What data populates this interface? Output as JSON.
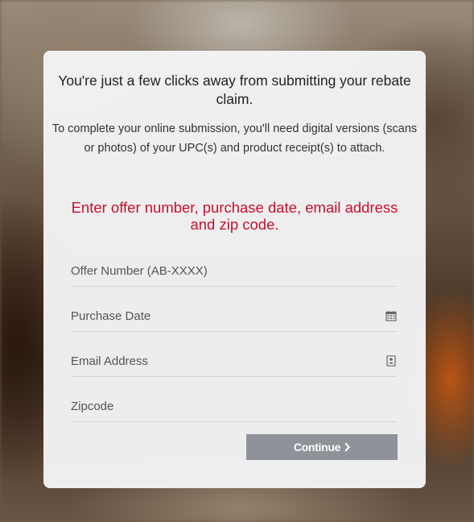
{
  "headline": "You're just a few clicks away from submitting your rebate claim.",
  "subtext": "To complete your online submission, you'll need digital versions (scans or photos) of your UPC(s) and product receipt(s) to attach.",
  "instruction": "Enter offer number, purchase date, email address and zip code.",
  "form": {
    "offer_number": {
      "placeholder": "Offer Number (AB-XXXX)",
      "value": ""
    },
    "purchase_date": {
      "placeholder": "Purchase Date",
      "value": "",
      "icon": "calendar-icon"
    },
    "email": {
      "placeholder": "Email Address",
      "value": "",
      "icon": "contact-card-icon"
    },
    "zipcode": {
      "placeholder": "Zipcode",
      "value": ""
    }
  },
  "continue_button": {
    "label": "Continue",
    "icon": "chevron-right-icon"
  },
  "colors": {
    "instruction_text": "#c8102e",
    "button_bg": "#8f9399",
    "card_bg": "#f5f5f6"
  }
}
